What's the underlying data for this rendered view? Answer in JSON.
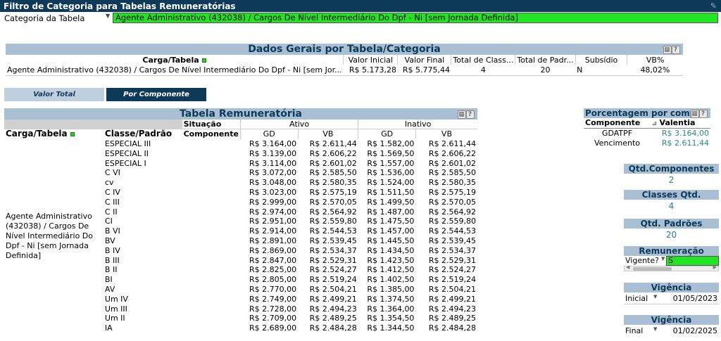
{
  "filter": {
    "title": "Filtro de Categoria para Tabelas Remuneratórias",
    "label": "Categoria da Tabela",
    "value": "Agente Administrativo (432038) / Cargos De Nível Intermediário Do Dpf - Ni [sem Jornada Definida]"
  },
  "dados_gerais": {
    "title": "Dados Gerais por Tabela/Categoria",
    "headers": [
      "Carga/Tabela",
      "Valor Inicial",
      "Valor Final",
      "Total de Class...",
      "Total de Padr...",
      "Subsídio",
      "VB%"
    ],
    "row": [
      "Agente Administrativo (432038) / Cargos De Nível Intermediário Do Dpf - Ni [sem Jor...",
      "R$ 5.173,28",
      "R$ 5.775,44",
      "4",
      "20",
      "N",
      "48,02%"
    ]
  },
  "tabs": {
    "valor_total": "Valor Total",
    "por_componente": "Por Componente"
  },
  "tabela": {
    "title": "Tabela Remuneratória",
    "situacao": "Situação",
    "componente": "Componente",
    "ativo": "Ativo",
    "inativo": "Inativo",
    "carga_header": "Carga/Tabela",
    "classe_header": "Classe/Padrão",
    "gd": "GD",
    "vb": "VB",
    "carga_value": "Agente Administrativo (432038) / Cargos De Nível Intermediário Do Dpf - Ni [sem Jornada Definida]",
    "rows": [
      [
        "ESPECIAL III",
        "R$ 3.164,00",
        "R$ 2.611,44",
        "R$ 1.582,00",
        "R$ 2.611,44"
      ],
      [
        "ESPECIAL II",
        "R$ 3.139,00",
        "R$ 2.606,22",
        "R$ 1.569,50",
        "R$ 2.606,22"
      ],
      [
        "ESPECIAL I",
        "R$ 3.114,00",
        "R$ 2.601,02",
        "R$ 1.557,00",
        "R$ 2.601,02"
      ],
      [
        "C VI",
        "R$ 3.072,00",
        "R$ 2.585,50",
        "R$ 1.536,00",
        "R$ 2.585,50"
      ],
      [
        "cv",
        "R$ 3.048,00",
        "R$ 2.580,35",
        "R$ 1.524,00",
        "R$ 2.580,35"
      ],
      [
        "C IV",
        "R$ 3.023,00",
        "R$ 2.575,19",
        "R$ 1.511,50",
        "R$ 2.575,19"
      ],
      [
        "C III",
        "R$ 2.999,00",
        "R$ 2.570,05",
        "R$ 1.499,50",
        "R$ 2.570,05"
      ],
      [
        "C II",
        "R$ 2.974,00",
        "R$ 2.564,92",
        "R$ 1.487,00",
        "R$ 2.564,92"
      ],
      [
        "CI",
        "R$ 2.951,00",
        "R$ 2.559,80",
        "R$ 1.475,50",
        "R$ 2.559,80"
      ],
      [
        "B VI",
        "R$ 2.914,00",
        "R$ 2.544,53",
        "R$ 1.457,00",
        "R$ 2.544,53"
      ],
      [
        "BV",
        "R$ 2.891,00",
        "R$ 2.539,45",
        "R$ 1.445,50",
        "R$ 2.539,45"
      ],
      [
        "B IV",
        "R$ 2.869,00",
        "R$ 2.534,37",
        "R$ 1.434,50",
        "R$ 2.534,37"
      ],
      [
        "B III",
        "R$ 2.847,00",
        "R$ 2.529,31",
        "R$ 1.423,50",
        "R$ 2.529,31"
      ],
      [
        "B II",
        "R$ 2.825,00",
        "R$ 2.524,27",
        "R$ 1.412,50",
        "R$ 2.524,27"
      ],
      [
        "BI",
        "R$ 2.805,00",
        "R$ 2.519,24",
        "R$ 1.402,50",
        "R$ 2.519,24"
      ],
      [
        "AV",
        "R$ 2.770,00",
        "R$ 2.504,21",
        "R$ 1.385,00",
        "R$ 2.504,21"
      ],
      [
        "Um IV",
        "R$ 2.749,00",
        "R$ 2.499,21",
        "R$ 1.374,50",
        "R$ 2.499,21"
      ],
      [
        "Um III",
        "R$ 2.728,00",
        "R$ 2.494,23",
        "R$ 1.364,00",
        "R$ 2.494,23"
      ],
      [
        "Um II",
        "R$ 2.709,00",
        "R$ 2.489,25",
        "R$ 1.354,50",
        "R$ 2.489,25"
      ],
      [
        "IA",
        "R$ 2.689,00",
        "R$ 2.484,28",
        "R$ 1.344,50",
        "R$ 2.484,28"
      ]
    ]
  },
  "porcentagem": {
    "title": "Porcentagem por comp...",
    "col_componente": "Componente",
    "col_valentia": "Valentia",
    "rows": [
      [
        "GDATPF",
        "R$ 3.164,00"
      ],
      [
        "Vencimento",
        "R$ 2.611,44"
      ]
    ]
  },
  "stats": {
    "qtd_componentes_label": "Qtd.Componentes",
    "qtd_componentes_value": "2",
    "classes_qtd_label": "Classes Qtd.",
    "classes_qtd_value": "4",
    "qtd_padroes_label": "Qtd. Padrões",
    "qtd_padroes_value": "20"
  },
  "remuneracao": {
    "title": "Remuneração",
    "label": "Vigente?",
    "value": "S"
  },
  "vigencia_inicial": {
    "title": "Vigência",
    "label": "Inicial",
    "date": "01/05/2023"
  },
  "vigencia_final": {
    "title": "Vigência",
    "label": "Final",
    "date": "01/02/2025"
  },
  "colors": {
    "header_dark": "#0e3a5a",
    "panel_blue": "#a9bfd3",
    "selection_green": "#22e522",
    "value_teal": "#2a8a8a"
  }
}
